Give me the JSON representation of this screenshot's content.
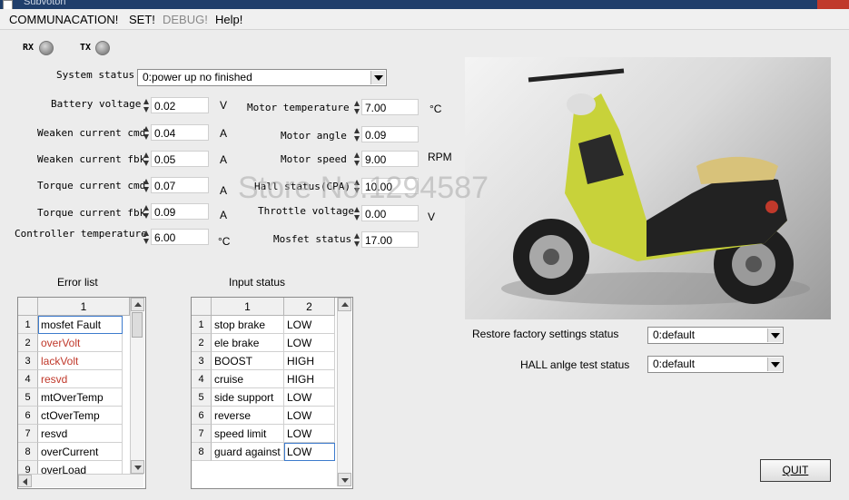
{
  "window": {
    "title": "Subvoton"
  },
  "menu": [
    {
      "label": "COMMUNACATION!",
      "disabled": false
    },
    {
      "label": "SET!",
      "disabled": false
    },
    {
      "label": "DEBUG!",
      "disabled": true
    },
    {
      "label": "Help!",
      "disabled": false
    }
  ],
  "leds": {
    "rx": "RX",
    "tx": "TX"
  },
  "system_status": {
    "label": "System status",
    "value": "0:power up no finished"
  },
  "fields_left": [
    {
      "label": "Battery voltage",
      "value": "0.02",
      "unit": "V"
    },
    {
      "label": "Weaken current cmd",
      "value": "0.04",
      "unit": "A"
    },
    {
      "label": "Weaken current fbk",
      "value": "0.05",
      "unit": "A"
    },
    {
      "label": "Torque current cmd",
      "value": "0.07",
      "unit": "A"
    },
    {
      "label": "Torque current fbk",
      "value": "0.09",
      "unit": "A"
    },
    {
      "label": "Controller temperature",
      "value": "6.00",
      "unit": "°C"
    }
  ],
  "fields_right": [
    {
      "label": "Motor temperature",
      "value": "7.00",
      "unit": "°C"
    },
    {
      "label": "Motor angle",
      "value": "0.09",
      "unit": ""
    },
    {
      "label": "Motor speed",
      "value": "9.00",
      "unit": "RPM"
    },
    {
      "label": "Hall status(CPA)",
      "value": "10.00",
      "unit": ""
    },
    {
      "label": "Throttle voltage",
      "value": "0.00",
      "unit": "V"
    },
    {
      "label": "Mosfet status",
      "value": "17.00",
      "unit": ""
    }
  ],
  "error_list": {
    "title": "Error list",
    "column": "1",
    "rows": [
      {
        "n": "1",
        "text": "mosfet Fault",
        "red": false
      },
      {
        "n": "2",
        "text": "overVolt",
        "red": true
      },
      {
        "n": "3",
        "text": "lackVolt",
        "red": true
      },
      {
        "n": "4",
        "text": "resvd",
        "red": true
      },
      {
        "n": "5",
        "text": "mtOverTemp",
        "red": false
      },
      {
        "n": "6",
        "text": "ctOverTemp",
        "red": false
      },
      {
        "n": "7",
        "text": "resvd",
        "red": false
      },
      {
        "n": "8",
        "text": "overCurrent",
        "red": false
      },
      {
        "n": "9",
        "text": "overLoad",
        "red": false
      }
    ]
  },
  "input_status": {
    "title": "Input status",
    "columns": [
      "1",
      "2"
    ],
    "rows": [
      {
        "n": "1",
        "name": "stop brake",
        "value": "LOW"
      },
      {
        "n": "2",
        "name": "ele brake",
        "value": "LOW"
      },
      {
        "n": "3",
        "name": "BOOST",
        "value": "HIGH"
      },
      {
        "n": "4",
        "name": "cruise",
        "value": "HIGH"
      },
      {
        "n": "5",
        "name": "side support",
        "value": "LOW"
      },
      {
        "n": "6",
        "name": "reverse",
        "value": "LOW"
      },
      {
        "n": "7",
        "name": "speed limit",
        "value": "LOW"
      },
      {
        "n": "8",
        "name": "guard against",
        "value": "LOW"
      }
    ]
  },
  "restore": {
    "label": "Restore factory settings status",
    "value": "0:default"
  },
  "hall_test": {
    "label": "HALL anlge test status",
    "value": "0:default"
  },
  "quit_label": "QUIT",
  "watermark": "Store No.1294587",
  "colors": {
    "titlebar": "#1f3e6b",
    "error_red": "#c0392b",
    "scooter_yellow": "#c8d23a"
  }
}
